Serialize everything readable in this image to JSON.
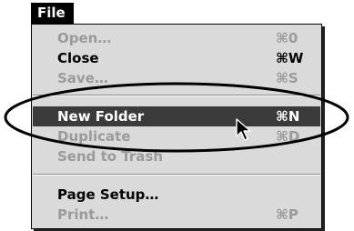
{
  "menubar": {
    "title": "File"
  },
  "menu": {
    "items": [
      {
        "label": "Open…",
        "shortcut": "⌘0",
        "enabled": false
      },
      {
        "label": "Close",
        "shortcut": "⌘W",
        "enabled": true
      },
      {
        "label": "Save…",
        "shortcut": "⌘S",
        "enabled": false
      },
      {
        "label": "New Folder",
        "shortcut": "⌘N",
        "enabled": true,
        "highlighted": true
      },
      {
        "label": "Duplicate",
        "shortcut": "⌘D",
        "enabled": false
      },
      {
        "label": "Send to Trash",
        "shortcut": "",
        "enabled": false
      },
      {
        "label": "Page Setup…",
        "shortcut": "",
        "enabled": true
      },
      {
        "label": "Print…",
        "shortcut": "⌘P",
        "enabled": false
      }
    ]
  },
  "annotation": {
    "type": "ellipse-highlight",
    "color": "#000000"
  },
  "cursor": {
    "icon": "arrow-pointer-icon"
  },
  "colors": {
    "menu_background": "#dadada",
    "highlight_background": "#3b3b3b",
    "disabled_text": "#9a9a9a",
    "enabled_text": "#000000"
  }
}
